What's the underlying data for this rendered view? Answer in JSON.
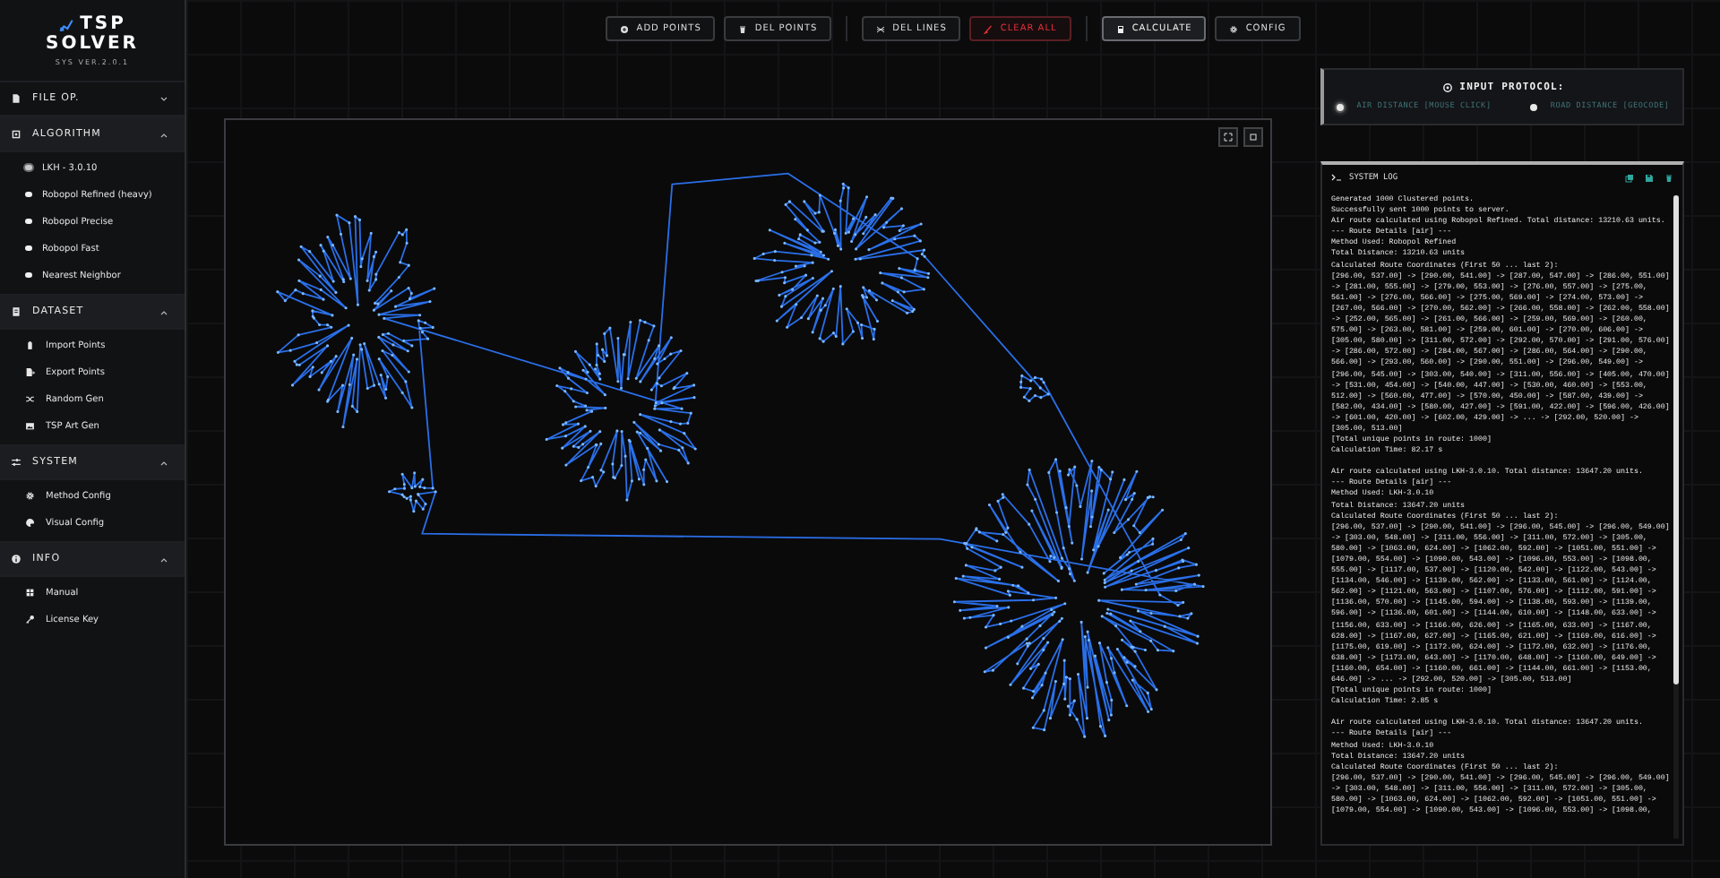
{
  "logo": {
    "title": [
      "TSP",
      "SOLVER"
    ],
    "version": "SYS VER.2.0.1"
  },
  "sidebar": {
    "sections": [
      {
        "label": "FILE OP.",
        "expanded": false
      },
      {
        "label": "ALGORITHM",
        "expanded": true,
        "items": [
          {
            "label": "LKH - 3.0.10",
            "kind": "radio",
            "selected": true
          },
          {
            "label": "Robopol Refined (heavy)",
            "kind": "radio",
            "selected": false
          },
          {
            "label": "Robopol Precise",
            "kind": "radio",
            "selected": false
          },
          {
            "label": "Robopol Fast",
            "kind": "radio",
            "selected": false
          },
          {
            "label": "Nearest Neighbor",
            "kind": "radio",
            "selected": false
          }
        ]
      },
      {
        "label": "DATASET",
        "expanded": true,
        "items": [
          {
            "label": "Import Points",
            "kind": "action"
          },
          {
            "label": "Export Points",
            "kind": "action"
          },
          {
            "label": "Random Gen",
            "kind": "action"
          },
          {
            "label": "TSP Art Gen",
            "kind": "action"
          }
        ]
      },
      {
        "label": "SYSTEM",
        "expanded": true,
        "items": [
          {
            "label": "Method Config",
            "kind": "action"
          },
          {
            "label": "Visual Config",
            "kind": "action"
          }
        ]
      },
      {
        "label": "INFO",
        "expanded": true,
        "items": [
          {
            "label": "Manual",
            "kind": "action"
          },
          {
            "label": "License Key",
            "kind": "action"
          }
        ]
      }
    ]
  },
  "toolbar": {
    "groups": [
      [
        {
          "label": "ADD POINTS",
          "kind": "normal"
        },
        {
          "label": "DEL POINTS",
          "kind": "normal"
        }
      ],
      [
        {
          "label": "DEL LINES",
          "kind": "normal"
        },
        {
          "label": "CLEAR ALL",
          "kind": "danger"
        }
      ],
      [
        {
          "label": "CALCULATE",
          "kind": "primary"
        },
        {
          "label": "CONFIG",
          "kind": "normal"
        }
      ]
    ]
  },
  "input_protocol": {
    "title": "INPUT PROTOCOL:",
    "options": [
      {
        "label": "AIR DISTANCE [MOUSE CLICK]",
        "selected": true
      },
      {
        "label": "ROAD DISTANCE [GEOCODE]",
        "selected": false
      }
    ]
  },
  "system_log": {
    "title": "SYSTEM LOG",
    "entries": [
      {
        "lines": [
          "Generated 1000 Clustered points.",
          "Successfully sent 1000 points to server.",
          "Air route calculated using Robopol Refined. Total distance: 13210.63 units.",
          "--- Route Details [air] ---",
          "Method Used: Robopol Refined",
          "Total Distance: 13210.63 units",
          "Calculated Route Coordinates (First 50 ... last 2):",
          "[296.00, 537.00] -> [290.00, 541.00] -> [287.00, 547.00] -> [286.00, 551.00]",
          "-> [281.00, 555.00] -> [279.00, 553.00] -> [276.00, 557.00] -> [275.00,",
          "561.00] -> [276.00, 566.00] -> [275.00, 569.00] -> [274.00, 573.00] ->",
          "[267.00, 566.00] -> [270.00, 562.00] -> [266.00, 558.00] -> [262.00, 558.00]",
          "-> [252.00, 565.00] -> [261.00, 566.00] -> [259.00, 569.00] -> [260.00,",
          "575.00] -> [263.00, 581.00] -> [259.00, 601.00] -> [270.00, 606.00] ->",
          "[305.00, 580.00] -> [311.00, 572.00] -> [292.00, 570.00] -> [291.00, 576.00]",
          "-> [286.00, 572.00] -> [284.00, 567.00] -> [286.00, 564.00] -> [290.00,",
          "566.00] -> [293.00, 560.00] -> [290.00, 551.00] -> [296.00, 549.00] ->",
          "[296.00, 545.00] -> [303.00, 540.00] -> [311.00, 556.00] -> [405.00, 470.00]",
          "-> [531.00, 454.00] -> [540.00, 447.00] -> [530.00, 460.00] -> [553.00,",
          "512.00] -> [560.00, 477.00] -> [570.00, 450.00] -> [587.00, 439.00] ->",
          "[582.00, 434.00] -> [580.00, 427.00] -> [591.00, 422.00] -> [596.00, 426.00]",
          "-> [601.00, 420.00] -> [602.00, 429.00] -> ... -> [292.00, 520.00] ->",
          "[305.00, 513.00]",
          "[Total unique points in route: 1000]",
          "Calculation Time: 82.17 s"
        ]
      },
      {
        "lines": [
          "Air route calculated using LKH-3.0.10. Total distance: 13647.20 units.",
          "--- Route Details [air] ---",
          "Method Used: LKH-3.0.10",
          "Total Distance: 13647.20 units",
          "Calculated Route Coordinates (First 50 ... last 2):",
          "[296.00, 537.00] -> [290.00, 541.00] -> [296.00, 545.00] -> [296.00, 549.00]",
          "-> [303.00, 548.00] -> [311.00, 556.00] -> [311.00, 572.00] -> [305.00,",
          "580.00] -> [1063.00, 624.00] -> [1062.00, 592.00] -> [1051.00, 551.00] ->",
          "[1079.00, 554.00] -> [1090.00, 543.00] -> [1096.00, 553.00] -> [1098.00,",
          "555.00] -> [1117.00, 537.00] -> [1120.00, 542.00] -> [1122.00, 543.00] ->",
          "[1134.00, 546.00] -> [1139.00, 562.00] -> [1133.00, 561.00] -> [1124.00,",
          "562.00] -> [1121.00, 563.00] -> [1107.00, 576.00] -> [1112.00, 591.00] ->",
          "[1136.00, 570.00] -> [1145.00, 594.00] -> [1138.00, 593.00] -> [1139.00,",
          "596.00] -> [1136.00, 601.00] -> [1144.00, 610.00] -> [1148.00, 633.00] ->",
          "[1156.00, 633.00] -> [1166.00, 626.00] -> [1165.00, 633.00] -> [1167.00,",
          "628.00] -> [1167.00, 627.00] -> [1165.00, 621.00] -> [1169.00, 616.00] ->",
          "[1175.00, 619.00] -> [1172.00, 624.00] -> [1172.00, 632.00] -> [1176.00,",
          "638.00] -> [1173.00, 643.00] -> [1170.00, 648.00] -> [1160.00, 649.00] ->",
          "[1160.00, 654.00] -> [1160.00, 661.00] -> [1144.00, 661.00] -> [1153.00,",
          "646.00] -> ... -> [292.00, 520.00] -> [305.00, 513.00]",
          "[Total unique points in route: 1000]",
          "Calculation Time: 2.85 s"
        ]
      },
      {
        "lines": [
          "Air route calculated using LKH-3.0.10. Total distance: 13647.20 units.",
          "--- Route Details [air] ---",
          "Method Used: LKH-3.0.10",
          "Total Distance: 13647.20 units",
          "Calculated Route Coordinates (First 50 ... last 2):",
          "[296.00, 537.00] -> [290.00, 541.00] -> [296.00, 545.00] -> [296.00, 549.00]",
          "-> [303.00, 548.00] -> [311.00, 556.00] -> [311.00, 572.00] -> [305.00,",
          "580.00] -> [1063.00, 624.00] -> [1062.00, 592.00] -> [1051.00, 551.00] ->",
          "[1079.00, 554.00] -> [1090.00, 543.00] -> [1096.00, 553.00] -> [1098.00,"
        ]
      }
    ]
  }
}
